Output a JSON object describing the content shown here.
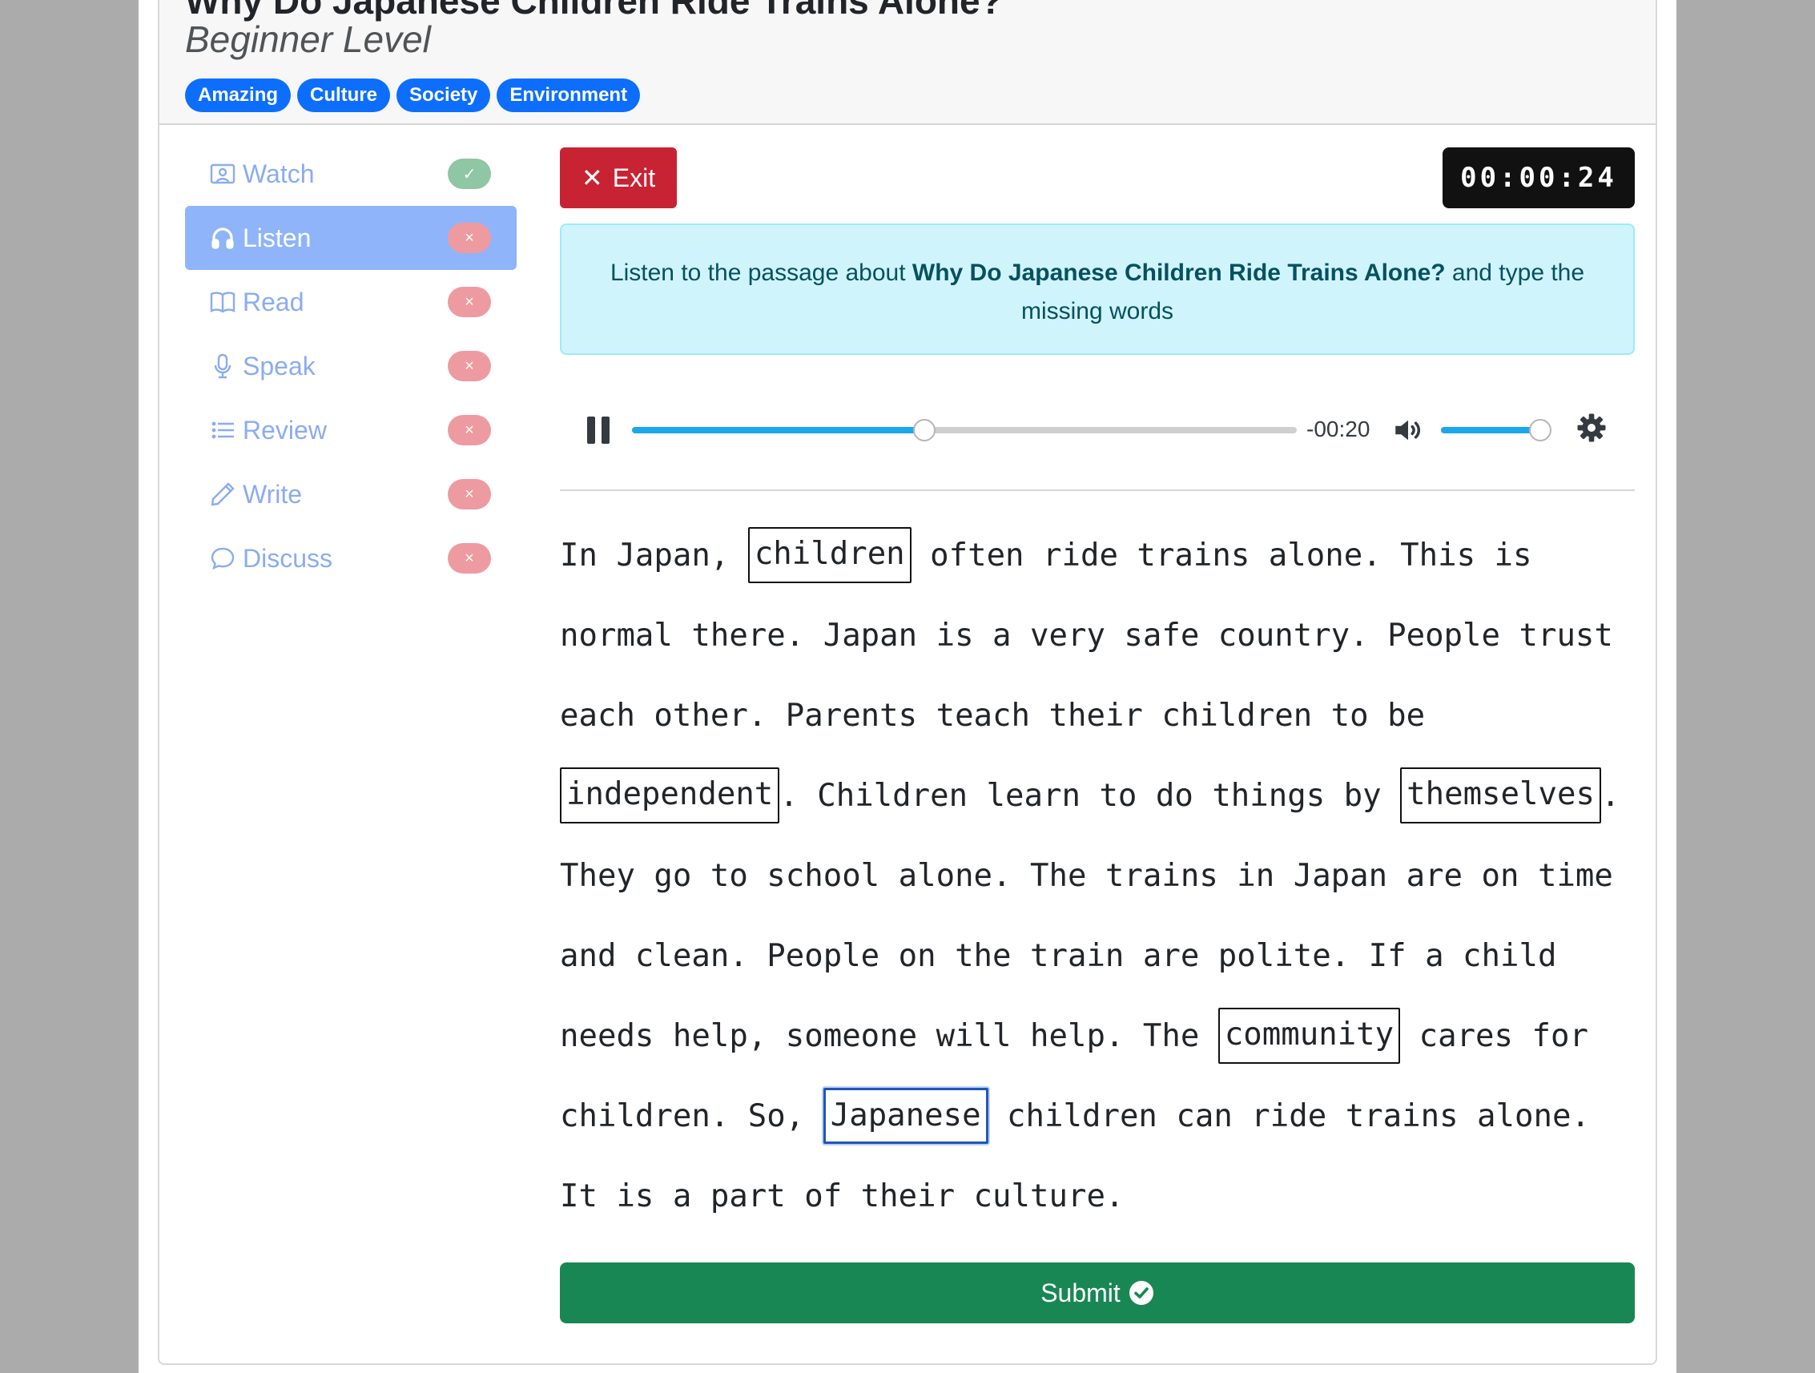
{
  "header": {
    "title": "Why Do Japanese Children Ride Trains Alone?",
    "level": "Beginner Level",
    "tags": [
      "Amazing",
      "Culture",
      "Society",
      "Environment"
    ]
  },
  "sidebar": {
    "items": [
      {
        "label": "Watch",
        "icon": "person-video-icon",
        "status": "✓",
        "done": true,
        "active": false
      },
      {
        "label": "Listen",
        "icon": "headphones-icon",
        "status": "×",
        "done": false,
        "active": true
      },
      {
        "label": "Read",
        "icon": "book-icon",
        "status": "×",
        "done": false,
        "active": false
      },
      {
        "label": "Speak",
        "icon": "mic-icon",
        "status": "×",
        "done": false,
        "active": false
      },
      {
        "label": "Review",
        "icon": "list-icon",
        "status": "×",
        "done": false,
        "active": false
      },
      {
        "label": "Write",
        "icon": "pencil-icon",
        "status": "×",
        "done": false,
        "active": false
      },
      {
        "label": "Discuss",
        "icon": "chat-icon",
        "status": "×",
        "done": false,
        "active": false
      }
    ]
  },
  "toolbar": {
    "exit_label": "Exit",
    "timer": "00:00:24"
  },
  "instruction": {
    "prefix": "Listen to the passage about ",
    "topic": "Why Do Japanese Children Ride Trains Alone?",
    "suffix": " and type the missing words"
  },
  "player": {
    "remaining": "-00:20",
    "progress_fraction": 0.44,
    "volume_fraction": 1.0
  },
  "passage": {
    "s1": "In Japan, ",
    "b1": "children",
    "s2": " often ride trains alone. This is normal there. Japan is a very safe country. People trust each other. Parents teach their children to be ",
    "b2": "independent",
    "s3": ". Children learn to do things by ",
    "b3": "themselves",
    "s4": ". They go to school alone. The trains in Japan are on time and clean. People on the train are polite. If a child needs help, someone will help. The ",
    "b4": "community",
    "s5": " cares for children. So, ",
    "b5": "Japanese",
    "s6": " children can ride trains alone. It is a part of their culture."
  },
  "submit": {
    "label": "Submit"
  },
  "colors": {
    "exit": "#c82333",
    "submit": "#198754",
    "tag": "#0d6efd",
    "active_nav": "#8fb4fa",
    "done": "#8fc6a4",
    "not_done": "#ee9aa1"
  }
}
